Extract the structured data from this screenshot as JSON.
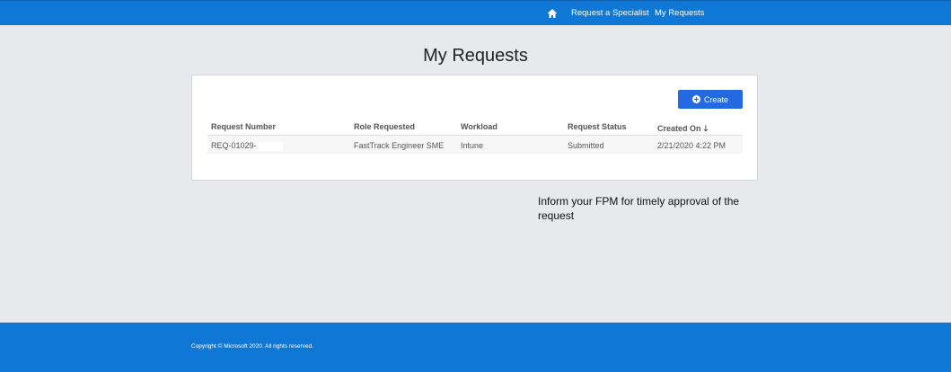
{
  "nav": {
    "home_icon": "home-icon",
    "links": [
      "Request a Specialist",
      "My Requests"
    ]
  },
  "page": {
    "title": "My Requests"
  },
  "toolbar": {
    "create_label": "Create",
    "create_icon": "plus-circle-icon"
  },
  "table": {
    "columns": [
      "Request Number",
      "Role Requested",
      "Workload",
      "Request Status",
      "Created On"
    ],
    "sorted_column_icon": "arrow-down-icon",
    "rows": [
      {
        "request_number": "REQ-01029-",
        "role": "FastTrack Engineer SME",
        "workload": "Intune",
        "status": "Submitted",
        "created_on": "2/21/2020 4:22 PM"
      }
    ]
  },
  "info": {
    "message": "Inform your FPM for timely approval of the request"
  },
  "footer": {
    "copyright": "Copyright © Microsoft 2020. All rights reserved."
  },
  "colors": {
    "brand_blue": "#0f78d7",
    "button_blue": "#2569e0",
    "background": "#e8e9ec"
  }
}
